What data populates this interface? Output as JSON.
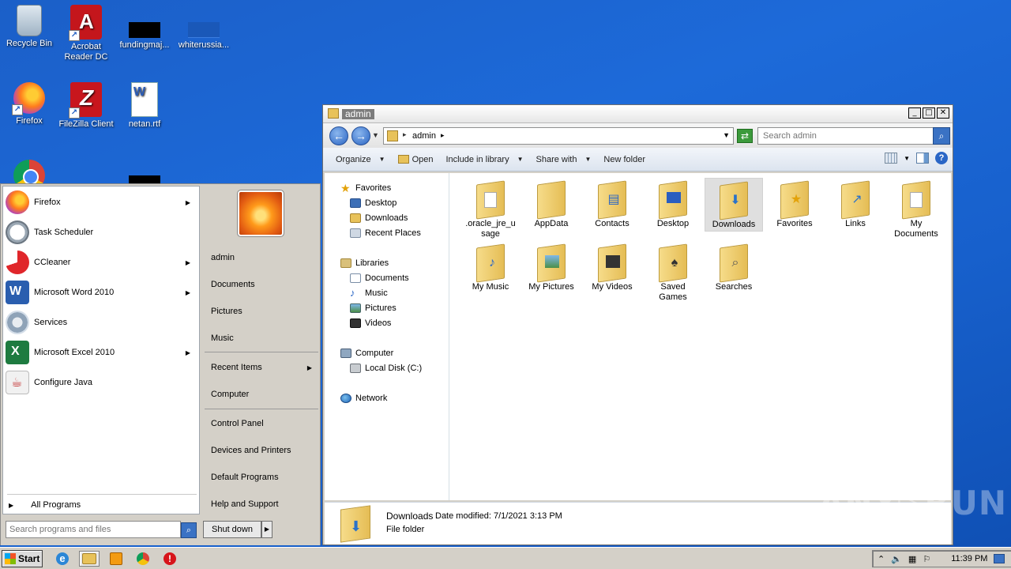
{
  "desktop": {
    "icons": [
      {
        "label": "Recycle Bin",
        "icon": "recycle-bin-icon"
      },
      {
        "label": "Acrobat Reader DC",
        "icon": "acrobat-icon"
      },
      {
        "label": "fundingmaj...",
        "icon": "file-icon"
      },
      {
        "label": "whiterussia...",
        "icon": "file-icon"
      },
      {
        "label": "Firefox",
        "icon": "firefox-icon"
      },
      {
        "label": "FileZilla Client",
        "icon": "filezilla-icon"
      },
      {
        "label": "netan.rtf",
        "icon": "rtf-document-icon"
      },
      {
        "label": "",
        "icon": "chrome-icon"
      }
    ],
    "acrobat_line1": "Acrobat",
    "acrobat_line2": "Reader DC",
    "watermark": "ANY▷RUN"
  },
  "explorer": {
    "title": "admin",
    "address": {
      "crumb": "admin"
    },
    "search": {
      "placeholder": "Search admin"
    },
    "toolbar": {
      "organize": "Organize",
      "open": "Open",
      "include": "Include in library",
      "share": "Share with",
      "newfolder": "New folder"
    },
    "nav": {
      "favorites": "Favorites",
      "desktop": "Desktop",
      "downloads": "Downloads",
      "recent": "Recent Places",
      "libraries": "Libraries",
      "documents": "Documents",
      "music": "Music",
      "pictures": "Pictures",
      "videos": "Videos",
      "computer": "Computer",
      "localdisk": "Local Disk (C:)",
      "network": "Network"
    },
    "files": [
      {
        "line1": ".oracle_jre_u",
        "line2": "sage"
      },
      {
        "line1": "AppData",
        "line2": ""
      },
      {
        "line1": "Contacts",
        "line2": ""
      },
      {
        "line1": "Desktop",
        "line2": ""
      },
      {
        "line1": "Downloads",
        "line2": ""
      },
      {
        "line1": "Favorites",
        "line2": ""
      },
      {
        "line1": "Links",
        "line2": ""
      },
      {
        "line1": "My",
        "line2": "Documents"
      },
      {
        "line1": "My Music",
        "line2": ""
      },
      {
        "line1": "My Pictures",
        "line2": ""
      },
      {
        "line1": "My Videos",
        "line2": ""
      },
      {
        "line1": "Saved",
        "line2": "Games"
      },
      {
        "line1": "Searches",
        "line2": ""
      }
    ],
    "details": {
      "name": "Downloads",
      "modified": "Date modified: 7/1/2021 3:13 PM",
      "type": "File folder"
    }
  },
  "startmenu": {
    "programs": [
      {
        "label": "Firefox",
        "has_submenu": true
      },
      {
        "label": "Task Scheduler",
        "has_submenu": false
      },
      {
        "label": "CCleaner",
        "has_submenu": true
      },
      {
        "label": "Microsoft Word 2010",
        "has_submenu": true
      },
      {
        "label": "Services",
        "has_submenu": false
      },
      {
        "label": "Microsoft Excel 2010",
        "has_submenu": true
      },
      {
        "label": "Configure Java",
        "has_submenu": false
      }
    ],
    "all_programs": "All Programs",
    "search_placeholder": "Search programs and files",
    "right": {
      "user": "admin",
      "documents": "Documents",
      "pictures": "Pictures",
      "music": "Music",
      "recent": "Recent Items",
      "computer": "Computer",
      "control_panel": "Control Panel",
      "devices": "Devices and Printers",
      "default_programs": "Default Programs",
      "help": "Help and Support"
    },
    "shutdown": "Shut down"
  },
  "taskbar": {
    "start": "Start",
    "clock": "11:39 PM"
  },
  "colors": {
    "desktop": "#1b5fc8",
    "chrome": "#d4d0c8",
    "selection": "#dfdfdf"
  }
}
